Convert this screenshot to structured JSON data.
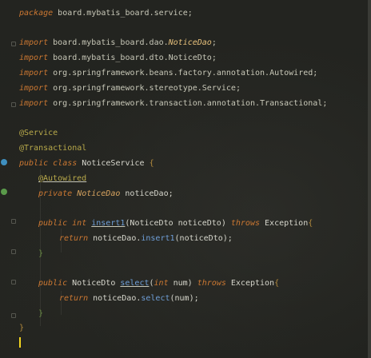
{
  "code": {
    "line1": {
      "kw": "package",
      "rest": " board.mybatis_board.service;"
    },
    "imports": [
      {
        "kw": "import",
        "pkg": " board.mybatis_board.dao.",
        "cls": "NoticeDao",
        "end": ";"
      },
      {
        "kw": "import",
        "pkg": " board.mybatis_board.dto.",
        "cls": "NoticeDto",
        "end": ";"
      },
      {
        "kw": "import",
        "pkg": " org.springframework.beans.factory.annotation.",
        "cls": "Autowired",
        "end": ";"
      },
      {
        "kw": "import",
        "pkg": " org.springframework.stereotype.",
        "cls": "Service",
        "end": ";"
      },
      {
        "kw": "import",
        "pkg": " org.springframework.transaction.annotation.",
        "cls": "Transactional",
        "end": ";"
      }
    ],
    "ann_service": "@Service",
    "ann_transactional": "@Transactional",
    "class_decl": {
      "kw1": "public",
      "kw2": "class",
      "name": "NoticeService",
      "brace": "{"
    },
    "ann_autowired": "@Autowired",
    "field_decl": {
      "kw": "private",
      "type": "NoticeDao",
      "name": "noticeDao;"
    },
    "method1": {
      "kw1": "public",
      "kw2": "int",
      "name": "insert1",
      "params": "(NoticeDto noticeDto)",
      "throws": "throws",
      "exc": "Exception",
      "brace": "{"
    },
    "return1": {
      "kw": "return",
      "obj": "noticeDao.",
      "call": "insert1",
      "args": "(noticeDto);"
    },
    "close1": "}",
    "method2": {
      "kw1": "public",
      "type": "NoticeDto",
      "name": "select",
      "params_open": "(",
      "ptype": "int",
      "pname": " num)",
      "throws": "throws",
      "exc": "Exception",
      "brace": "{"
    },
    "return2": {
      "kw": "return",
      "obj": "noticeDao.",
      "call": "select",
      "args": "(num);"
    },
    "close2": "}",
    "class_close": "}"
  },
  "colors": {
    "keyword": "#cc7832",
    "annotation": "#b8a94a",
    "method": "#6f9fd8",
    "caret": "#f2d41f"
  }
}
